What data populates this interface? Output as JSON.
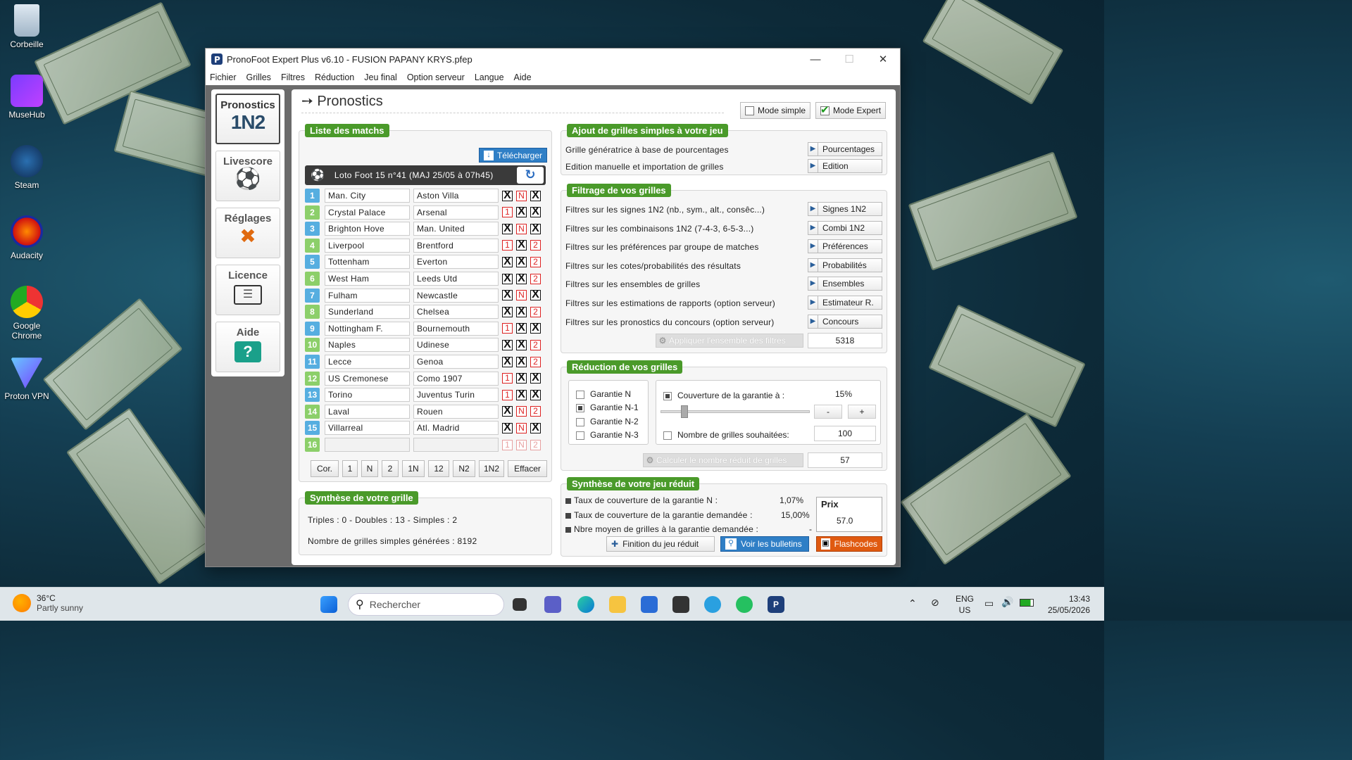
{
  "desktop": {
    "icons": [
      {
        "label": "Corbeille",
        "icon": "recycle-bin-icon"
      },
      {
        "label": "MuseHub",
        "icon": "musehub-icon"
      },
      {
        "label": "Steam",
        "icon": "steam-icon"
      },
      {
        "label": "Audacity",
        "icon": "audacity-icon"
      },
      {
        "label": "Google Chrome",
        "icon": "chrome-icon"
      },
      {
        "label": "Proton VPN",
        "icon": "protonvpn-icon"
      }
    ]
  },
  "window": {
    "title": "PronoFoot Expert Plus v6.10 - FUSION PAPANY KRYS.pfep",
    "minimize": "—",
    "maximize": "☐",
    "close": "✕"
  },
  "menu": [
    "Fichier",
    "Grilles",
    "Filtres",
    "Réduction",
    "Jeu final",
    "Option serveur",
    "Langue",
    "Aide"
  ],
  "sidebar": {
    "pronostics": {
      "label": "Pronostics",
      "sub": "1N2"
    },
    "livescore": {
      "label": "Livescore",
      "icon": "soccer-ball-icon"
    },
    "reglages": {
      "label": "Réglages",
      "icon": "tools-icon"
    },
    "licence": {
      "label": "Licence",
      "icon": "id-card-icon"
    },
    "aide": {
      "label": "Aide",
      "icon": "help-bubble-icon"
    }
  },
  "page": {
    "title": "Pronostics",
    "mode_simple": "Mode simple",
    "mode_expert": "Mode Expert",
    "mode_expert_checked": true
  },
  "matches": {
    "header": "Liste des matchs",
    "download": "Télécharger",
    "loto": "Loto Foot 15 n°41 (MAJ 25/05 à 07h45)",
    "rows": [
      {
        "n": "1",
        "home": "Man. City",
        "away": "Aston Villa",
        "s": [
          "X",
          "N",
          "X"
        ]
      },
      {
        "n": "2",
        "home": "Crystal Palace",
        "away": "Arsenal",
        "s": [
          "1",
          "X",
          "X"
        ]
      },
      {
        "n": "3",
        "home": "Brighton Hove",
        "away": "Man. United",
        "s": [
          "X",
          "N",
          "X"
        ]
      },
      {
        "n": "4",
        "home": "Liverpool",
        "away": "Brentford",
        "s": [
          "1",
          "X",
          "2"
        ]
      },
      {
        "n": "5",
        "home": "Tottenham",
        "away": "Everton",
        "s": [
          "X",
          "X",
          "2"
        ]
      },
      {
        "n": "6",
        "home": "West Ham",
        "away": "Leeds Utd",
        "s": [
          "X",
          "X",
          "2"
        ]
      },
      {
        "n": "7",
        "home": "Fulham",
        "away": "Newcastle",
        "s": [
          "X",
          "N",
          "X"
        ]
      },
      {
        "n": "8",
        "home": "Sunderland",
        "away": "Chelsea",
        "s": [
          "X",
          "X",
          "2"
        ]
      },
      {
        "n": "9",
        "home": "Nottingham F.",
        "away": "Bournemouth",
        "s": [
          "1",
          "X",
          "X"
        ]
      },
      {
        "n": "10",
        "home": "Naples",
        "away": "Udinese",
        "s": [
          "X",
          "X",
          "2"
        ]
      },
      {
        "n": "11",
        "home": "Lecce",
        "away": "Genoa",
        "s": [
          "X",
          "X",
          "2"
        ]
      },
      {
        "n": "12",
        "home": "US Cremonese",
        "away": "Como 1907",
        "s": [
          "1",
          "X",
          "X"
        ]
      },
      {
        "n": "13",
        "home": "Torino",
        "away": "Juventus Turin",
        "s": [
          "1",
          "X",
          "X"
        ]
      },
      {
        "n": "14",
        "home": "Laval",
        "away": "Rouen",
        "s": [
          "X",
          "N",
          "2"
        ]
      },
      {
        "n": "15",
        "home": "Villarreal",
        "away": "Atl. Madrid",
        "s": [
          "X",
          "N",
          "X"
        ]
      },
      {
        "n": "16",
        "home": "",
        "away": "",
        "s": [
          "1",
          "N",
          "2"
        ]
      }
    ],
    "buttons": [
      "Cor.",
      "1",
      "N",
      "2",
      "1N",
      "12",
      "N2",
      "1N2",
      "Effacer"
    ]
  },
  "synthese_grille": {
    "header": "Synthèse de votre grille",
    "line1": "Triples : 0 - Doubles : 13 - Simples : 2",
    "line2": "Nombre de grilles simples générées : 8192"
  },
  "ajout": {
    "header": "Ajout de grilles simples à votre jeu",
    "rows": [
      {
        "label": "Grille génératrice à base de pourcentages",
        "button": "Pourcentages"
      },
      {
        "label": "Edition manuelle et importation de grilles",
        "button": "Edition"
      }
    ]
  },
  "filtrage": {
    "header": "Filtrage de vos grilles",
    "rows": [
      {
        "label": "Filtres sur les signes 1N2 (nb., sym., alt., consêc...)",
        "button": "Signes 1N2"
      },
      {
        "label": "Filtres sur les combinaisons 1N2 (7-4-3, 6-5-3...)",
        "button": "Combi 1N2"
      },
      {
        "label": "Filtres sur les préférences par groupe de matches",
        "button": "Préférences"
      },
      {
        "label": "Filtres sur les cotes/probabilités des résultats",
        "button": "Probabilités"
      },
      {
        "label": "Filtres sur les ensembles de grilles",
        "button": "Ensembles"
      },
      {
        "label": "Filtres sur les estimations de rapports (option serveur)",
        "button": "Estimateur R."
      },
      {
        "label": "Filtres sur les pronostics du concours (option serveur)",
        "button": "Concours"
      }
    ],
    "apply": "Appliquer l'ensemble des filtres",
    "count": "5318"
  },
  "reduction": {
    "header": "Réduction de vos grilles",
    "garanties": [
      "Garantie N",
      "Garantie N-1",
      "Garantie N-2",
      "Garantie N-3"
    ],
    "selected": 1,
    "couverture_label": "Couverture de la garantie à :",
    "couverture_value": "15%",
    "slider_level": 0.15,
    "minus": "-",
    "plus": "+",
    "nb_label": "Nombre de grilles souhaitées:",
    "nb_value": "100",
    "calc": "Calculer le nombre réduit de grilles",
    "result": "57"
  },
  "synthese_jeu": {
    "header": "Synthèse de votre jeu réduit",
    "rows": [
      {
        "label": "Taux de couverture de la garantie N :",
        "value": "1,07%"
      },
      {
        "label": "Taux de couverture de la garantie demandée :",
        "value": "15,00%"
      },
      {
        "label": "Nbre moyen de grilles à la garantie demandée :",
        "value": "-"
      }
    ],
    "prix_label": "Prix",
    "prix_value": "57.0",
    "finition": "Finition du jeu réduit",
    "voir": "Voir les bulletins",
    "flash": "Flashcodes"
  },
  "taskbar": {
    "temp": "36°C",
    "weather": "Partly sunny",
    "search": "Rechercher",
    "lang1": "ENG",
    "lang2": "US",
    "time": "13:43",
    "date": "25/05/2026"
  },
  "colors": {
    "green_tag": "#4a9a2a",
    "blue_num": "#56aee0",
    "green_num": "#8ccf6a",
    "flash": "#e05a10",
    "voir": "#2f7fc6"
  }
}
